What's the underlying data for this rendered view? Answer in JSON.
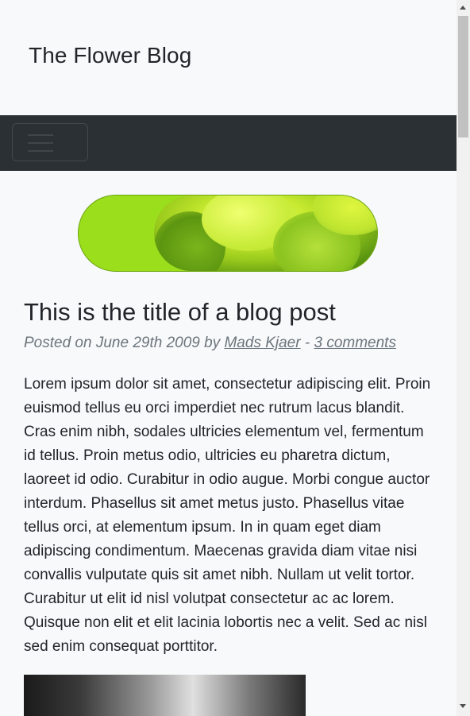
{
  "site": {
    "title": "The Flower Blog"
  },
  "navbar": {
    "toggler_icon": "hamburger-menu-icon"
  },
  "banner": {
    "image": "flower-banner-image"
  },
  "post": {
    "title": "This is the title of a blog post",
    "meta": {
      "prefix": "Posted on June 29th 2009 by ",
      "author": "Mads Kjaer",
      "separator": " - ",
      "comments": "3 comments"
    },
    "body": "Lorem ipsum dolor sit amet, consectetur adipiscing elit. Proin euismod tellus eu orci imperdiet nec rutrum lacus blandit. Cras enim nibh, sodales ultricies elementum vel, fermentum id tellus. Proin metus odio, ultricies eu pharetra dictum, laoreet id odio. Curabitur in odio augue. Morbi congue auctor interdum. Phasellus sit amet metus justo. Phasellus vitae tellus orci, at elementum ipsum. In in quam eget diam adipiscing condimentum. Maecenas gravida diam vitae nisi convallis vulputate quis sit amet nibh. Nullam ut velit tortor. Curabitur ut elit id nisl volutpat consectetur ac ac lorem. Quisque non elit et elit lacinia lobortis nec a velit. Sed ac nisl sed enim consequat porttitor."
  },
  "colors": {
    "navbar": "#2b3035",
    "background": "#f8f9fa",
    "banner_green": "#9ade1c",
    "meta_text": "#6c757d"
  }
}
